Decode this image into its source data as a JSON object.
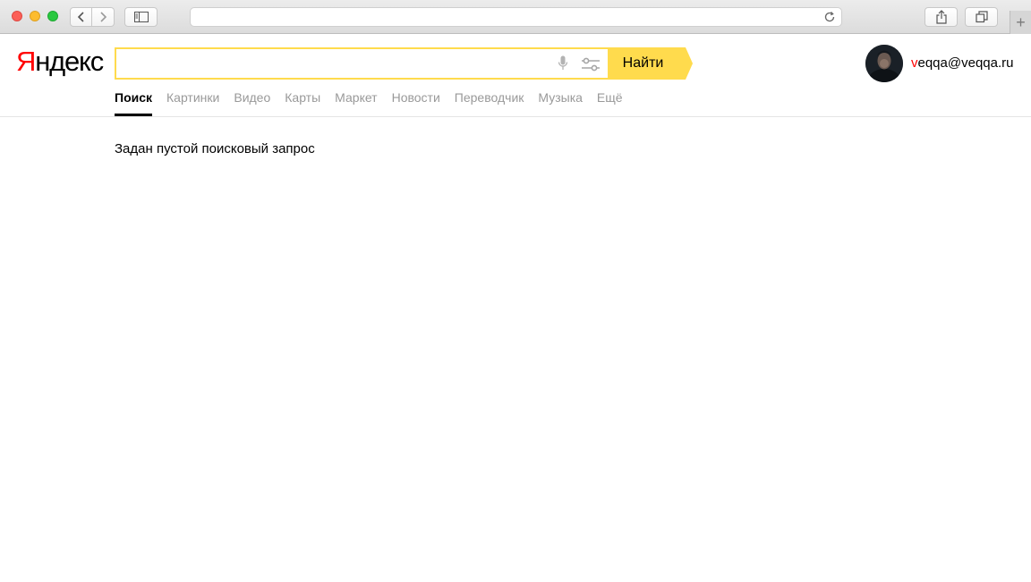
{
  "browser": {
    "url": "",
    "new_tab_glyph": "+",
    "icons": {
      "back": "chevron-left-icon",
      "forward": "chevron-right-icon",
      "sidebar": "sidebar-icon",
      "reload": "reload-icon",
      "share": "share-icon",
      "tabs": "tabs-overview-icon"
    }
  },
  "header": {
    "logo": {
      "first": "Я",
      "rest": "ндекс"
    },
    "search": {
      "value": "",
      "placeholder": "",
      "button_label": "Найти",
      "icons": {
        "voice": "microphone-icon",
        "settings": "sliders-icon"
      }
    },
    "user": {
      "login_first": "v",
      "login_rest": "eqqa@veqqa.ru",
      "avatar": "avatar-photo"
    }
  },
  "nav": {
    "tabs": [
      {
        "label": "Поиск",
        "active": true
      },
      {
        "label": "Картинки",
        "active": false
      },
      {
        "label": "Видео",
        "active": false
      },
      {
        "label": "Карты",
        "active": false
      },
      {
        "label": "Маркет",
        "active": false
      },
      {
        "label": "Новости",
        "active": false
      },
      {
        "label": "Переводчик",
        "active": false
      },
      {
        "label": "Музыка",
        "active": false
      },
      {
        "label": "Ещё",
        "active": false
      }
    ]
  },
  "main": {
    "message": "Задан пустой поисковый запрос"
  },
  "colors": {
    "brand_red": "#ff0000",
    "accent_yellow": "#ffdb4d",
    "nav_inactive": "#999999"
  }
}
